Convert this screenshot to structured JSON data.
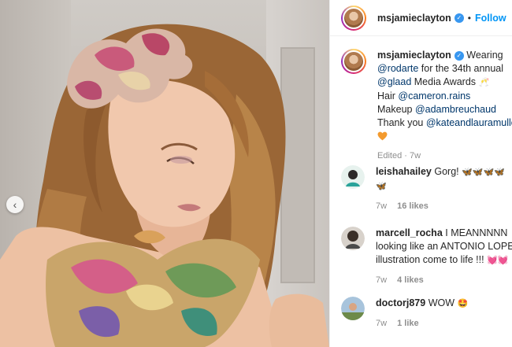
{
  "post": {
    "username": "msjamieclayton",
    "follow_label": "Follow",
    "dot": "•",
    "caption": {
      "lead": "Wearing",
      "mention_1": "@rodarte",
      "text_1": "for the 34th annual",
      "mention_2": "@glaad",
      "text_2": "Media Awards",
      "emoji_1": "🥂",
      "hair_label": "Hair",
      "mention_3": "@cameron.rains",
      "makeup_label": "Makeup",
      "mention_4": "@adambreuchaud",
      "thanks_label": "Thank you",
      "mention_5": "@kateandlauramulleavy",
      "meta": "Edited · 7w"
    }
  },
  "comments": [
    {
      "username": "leishahailey",
      "text": "Gorg!",
      "emoji": "🦋🦋🦋🦋",
      "emoji_2": "🦋",
      "age": "7w",
      "likes": "16 likes"
    },
    {
      "username": "marcell_rocha",
      "text": "I MEANNNNN",
      "text_2": "looking like an ANTONIO LOPEZ",
      "text_3": "illustration come to life !!!",
      "emoji": "💓💓",
      "age": "7w",
      "likes": "4 likes"
    },
    {
      "username": "doctorj879",
      "text": "WOW",
      "emoji": "🤩",
      "age": "7w",
      "likes": "1 like"
    }
  ],
  "icons": {
    "carousel_prev": "‹",
    "verified": "✓"
  },
  "colors": {
    "accent": "#0095f6",
    "verified": "#3897f0",
    "heart": "#f39a2e",
    "meta": "#8e8e8e"
  }
}
